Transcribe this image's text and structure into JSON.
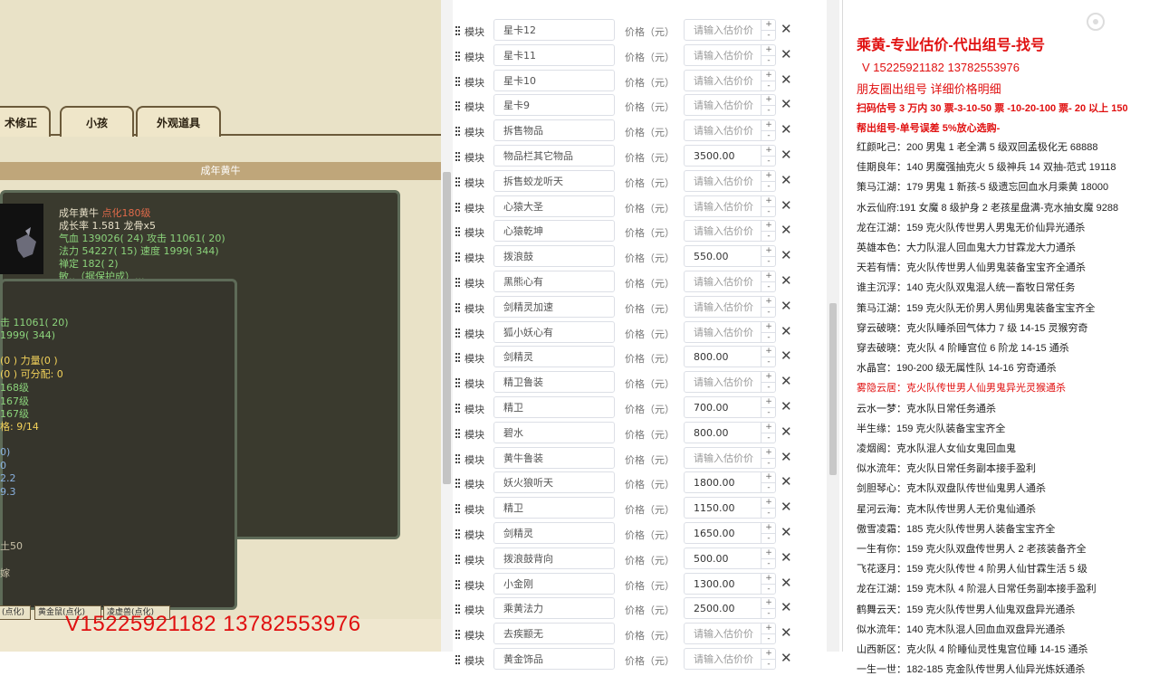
{
  "game": {
    "tabs": [
      "术修正",
      "小孩",
      "外观道具"
    ],
    "panel_title": "成年黄牛",
    "stats_main": {
      "name": "成年黄牛",
      "level": "点化180级",
      "growth": "成长率 1.581 龙骨x5",
      "hp": "气血 139026( 24) 攻击 11061( 20)",
      "mp": "法力 54227( 15) 速度 1999( 344)",
      "stability": "禅定 182( 2)",
      "partial": "敏..（据保护成）..."
    },
    "stats_sub": [
      "击 11061( 20)",
      "1999( 344)",
      "(0 ) 力量(0 )",
      "(0 ) 可分配: 0",
      "168级",
      "167级",
      "167级",
      "格: 9/14",
      "0)",
      "0",
      "2.2",
      "9.3",
      "土50",
      "嫁"
    ],
    "bottom_tabs": [
      "(点化)",
      "黄金鼠(点化)",
      "凌虚兽(点化)"
    ],
    "phone_overlay": "V15225921182   13782553976"
  },
  "form": {
    "module_label": "模块",
    "price_label": "价格（元）",
    "price_placeholder": "请输入估价价",
    "rows": [
      {
        "name": "星卡12",
        "price": ""
      },
      {
        "name": "星卡11",
        "price": ""
      },
      {
        "name": "星卡10",
        "price": ""
      },
      {
        "name": "星卡9",
        "price": ""
      },
      {
        "name": "拆售物品",
        "price": ""
      },
      {
        "name": "物品栏其它物品",
        "price": "3500.00"
      },
      {
        "name": "拆售蛟龙听天",
        "price": ""
      },
      {
        "name": "心猿大圣",
        "price": ""
      },
      {
        "name": "心猿乾坤",
        "price": ""
      },
      {
        "name": "拨浪鼓",
        "price": "550.00"
      },
      {
        "name": "黑熊心有",
        "price": ""
      },
      {
        "name": "剑精灵加速",
        "price": ""
      },
      {
        "name": "狐小妖心有",
        "price": ""
      },
      {
        "name": "剑精灵",
        "price": "800.00"
      },
      {
        "name": "精卫鲁装",
        "price": ""
      },
      {
        "name": "精卫",
        "price": "700.00"
      },
      {
        "name": "碧水",
        "price": "800.00"
      },
      {
        "name": "黄牛鲁装",
        "price": ""
      },
      {
        "name": "妖火狼听天",
        "price": "1800.00"
      },
      {
        "name": "精卫",
        "price": "1150.00"
      },
      {
        "name": "剑精灵",
        "price": "1650.00"
      },
      {
        "name": "拨浪鼓背向",
        "price": "500.00"
      },
      {
        "name": "小金刚",
        "price": "1300.00"
      },
      {
        "name": "乘黄法力",
        "price": "2500.00"
      },
      {
        "name": "去疾颛无",
        "price": ""
      },
      {
        "name": "黄金饰品",
        "price": ""
      }
    ]
  },
  "info": {
    "title": "乘黄-专业估价-代出组号-找号",
    "phones": "V 15225921182   13782553976",
    "moments": "朋友圈出组号   详细价格明细",
    "scan_price": "扫码估号 3 万内 30 票-3-10-50 票  -10-20-100 票- 20 以上 150",
    "help_sell": "帮出组号-单号误差 5%放心选购-",
    "lines": [
      {
        "text": "红颜叱己：200 男鬼 1 老全满 5 级双回孟极化无 68888",
        "red": false
      },
      {
        "text": "佳期良年：140 男魔强抽克火 5 级神兵 14 双抽-范式 19118",
        "red": false
      },
      {
        "text": "策马江湖：179 男鬼 1 新孩-5 级遗忘回血水月乘黄 18000",
        "red": false
      },
      {
        "text": "水云仙府:191 女魔 8 级护身 2 老孩星盘满-克水抽女魔 9288",
        "red": false
      },
      {
        "text": "龙在江湖：159 克火队传世男人男鬼无价仙异光通杀",
        "red": false
      },
      {
        "text": "英雄本色：大力队混人回血鬼大力甘霖龙大力通杀",
        "red": false
      },
      {
        "text": "天若有情：克火队传世男人仙男鬼装备宝宝齐全通杀",
        "red": false
      },
      {
        "text": "谁主沉浮：140 克火队双鬼混人统一畜牧日常任务",
        "red": false
      },
      {
        "text": "策马江湖：159 克火队无价男人男仙男鬼装备宝宝齐全",
        "red": false
      },
      {
        "text": "穿云破晓：克火队睡杀回气体力 7 级 14-15 灵猴穷奇",
        "red": false
      },
      {
        "text": "穿去破晓：克火队 4 阶睡宫位 6 阶龙 14-15 通杀",
        "red": false
      },
      {
        "text": "水晶宫：190-200 级无属性队 14-16 穷奇通杀",
        "red": false
      },
      {
        "text": "雾隐云居：克火队传世男人仙男鬼异光灵猴通杀",
        "red": true
      },
      {
        "text": "云水一梦：克水队日常任务通杀",
        "red": false
      },
      {
        "text": "半生缘：159 克火队装备宝宝齐全",
        "red": false
      },
      {
        "text": "凌烟阁：克水队混人女仙女鬼回血鬼",
        "red": false
      },
      {
        "text": "似水流年：克火队日常任务副本接手盈利",
        "red": false
      },
      {
        "text": "剑胆琴心：克木队双盘队传世仙鬼男人通杀",
        "red": false
      },
      {
        "text": "星河云海：克木队传世男人无价鬼仙通杀",
        "red": false
      },
      {
        "text": "傲雪凌霜：185 克火队传世男人装备宝宝齐全",
        "red": false
      },
      {
        "text": "一生有你：159 克火队双盘传世男人 2 老孩装备齐全",
        "red": false
      },
      {
        "text": "飞花逐月：159 克火队传世 4 阶男人仙甘霖生活 5 级",
        "red": false
      },
      {
        "text": "龙在江湖：159 克木队 4 阶混人日常任务副本接手盈利",
        "red": false
      },
      {
        "text": "鹤舞云天：159 克火队传世男人仙鬼双盘异光通杀",
        "red": false
      },
      {
        "text": "似水流年：140 克木队混人回血血双盘异光通杀",
        "red": false
      },
      {
        "text": "山西新区：克火队 4 阶睡仙灵性鬼宫位睡 14-15 通杀",
        "red": false
      },
      {
        "text": "一生一世：182-185 克金队传世男人仙异光炼妖通杀",
        "red": false
      }
    ]
  }
}
